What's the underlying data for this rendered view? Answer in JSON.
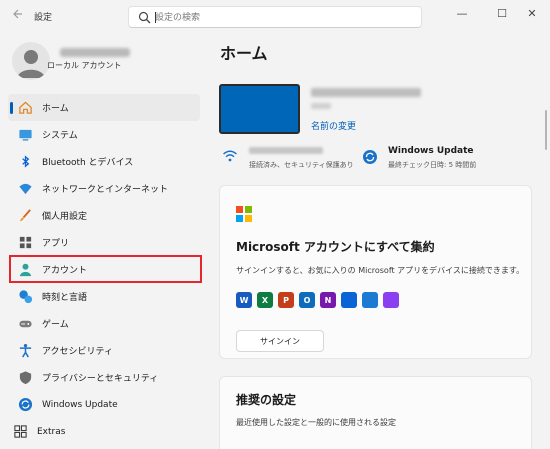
{
  "window": {
    "title": "設定",
    "search_placeholder": "設定の検索",
    "minimize": "—",
    "maximize": "☐",
    "close": "✕"
  },
  "profile": {
    "type": "ローカル アカウント"
  },
  "sidebar": {
    "items": [
      {
        "label": "ホーム",
        "icon": "home-icon",
        "active": true
      },
      {
        "label": "システム",
        "icon": "system-icon"
      },
      {
        "label": "Bluetooth とデバイス",
        "icon": "bluetooth-icon"
      },
      {
        "label": "ネットワークとインターネット",
        "icon": "network-icon"
      },
      {
        "label": "個人用設定",
        "icon": "personalization-icon"
      },
      {
        "label": "アプリ",
        "icon": "apps-icon"
      },
      {
        "label": "アカウント",
        "icon": "accounts-icon"
      },
      {
        "label": "時刻と言語",
        "icon": "time-language-icon"
      },
      {
        "label": "ゲーム",
        "icon": "gaming-icon"
      },
      {
        "label": "アクセシビリティ",
        "icon": "accessibility-icon"
      },
      {
        "label": "プライバシーとセキュリティ",
        "icon": "privacy-shield-icon"
      },
      {
        "label": "Windows Update",
        "icon": "windows-update-icon"
      },
      {
        "label": "Extras",
        "icon": "extras-icon"
      }
    ]
  },
  "main": {
    "title": "ホーム",
    "device": {
      "rename_link": "名前の変更"
    },
    "status": {
      "network_text": "接続済み、セキュリティ保護あり",
      "update_title": "Windows Update",
      "update_text": "最終チェック日時: 5 時間前"
    },
    "ms_account_card": {
      "title": "Microsoft アカウントにすべて集約",
      "description": "サインインすると、お気に入りの Microsoft アプリをデバイスに接続できます。",
      "signin_button": "サインイン",
      "apps": [
        {
          "name": "word-icon",
          "letter": "W",
          "color": "#185abd"
        },
        {
          "name": "excel-icon",
          "letter": "X",
          "color": "#107c41"
        },
        {
          "name": "powerpoint-icon",
          "letter": "P",
          "color": "#c43e1c"
        },
        {
          "name": "outlook-icon",
          "letter": "O",
          "color": "#0f6cbd"
        },
        {
          "name": "onenote-icon",
          "letter": "N",
          "color": "#7719aa"
        },
        {
          "name": "onedrive-icon",
          "letter": "",
          "color": "#0a64d6"
        },
        {
          "name": "defender-icon",
          "letter": "",
          "color": "#1b7ad2"
        },
        {
          "name": "clipchamp-icon",
          "letter": "",
          "color": "#8a3ff0"
        }
      ]
    },
    "recommended_card": {
      "title": "推奨の設定",
      "description": "最近使用した設定と一般的に使用される設定"
    }
  },
  "colors": {
    "accent": "#005fb8",
    "highlight_box": "#e5262c",
    "device_thumbnail": "#0066b8"
  }
}
